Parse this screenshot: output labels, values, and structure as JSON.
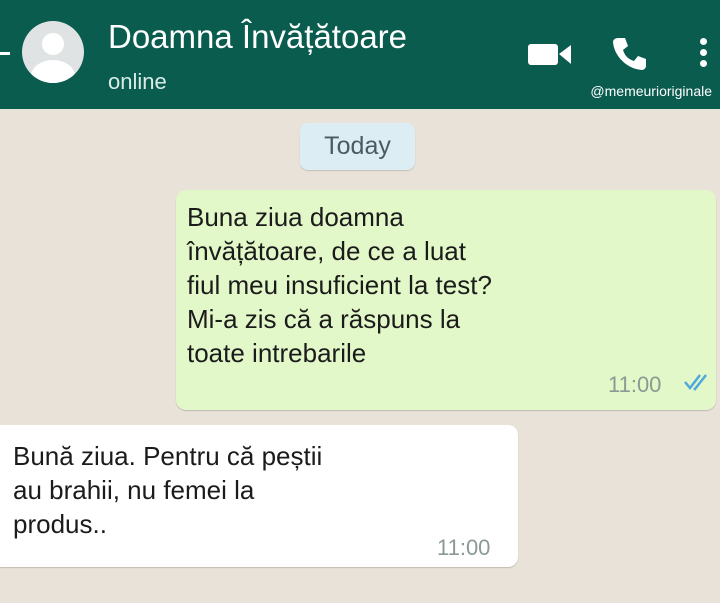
{
  "header": {
    "contact_name": "Doamna Învățătoare",
    "status": "online",
    "watermark": "@memeurioriginale",
    "icons": [
      "back-arrow-icon",
      "avatar-placeholder-icon",
      "video-call-icon",
      "phone-call-icon",
      "more-options-icon"
    ],
    "background_color": "#0a5c4f"
  },
  "chat": {
    "date_chip": "Today",
    "messages": [
      {
        "direction": "outgoing",
        "text": "Buna ziua doamna\nînvățătoare, de ce a luat\nfiul meu insuficient la test?\nMi-a zis că a răspuns la\ntoate intrebarile",
        "time": "11:00",
        "read_receipt": "double-check-blue",
        "bubble_color": "#e3f8c9"
      },
      {
        "direction": "incoming",
        "text": "Bună ziua. Pentru că peștii\nau brahii, nu femei la\nprodus..",
        "time": "11:00",
        "bubble_color": "#ffffff"
      }
    ],
    "background_color": "#e8e2d9"
  }
}
